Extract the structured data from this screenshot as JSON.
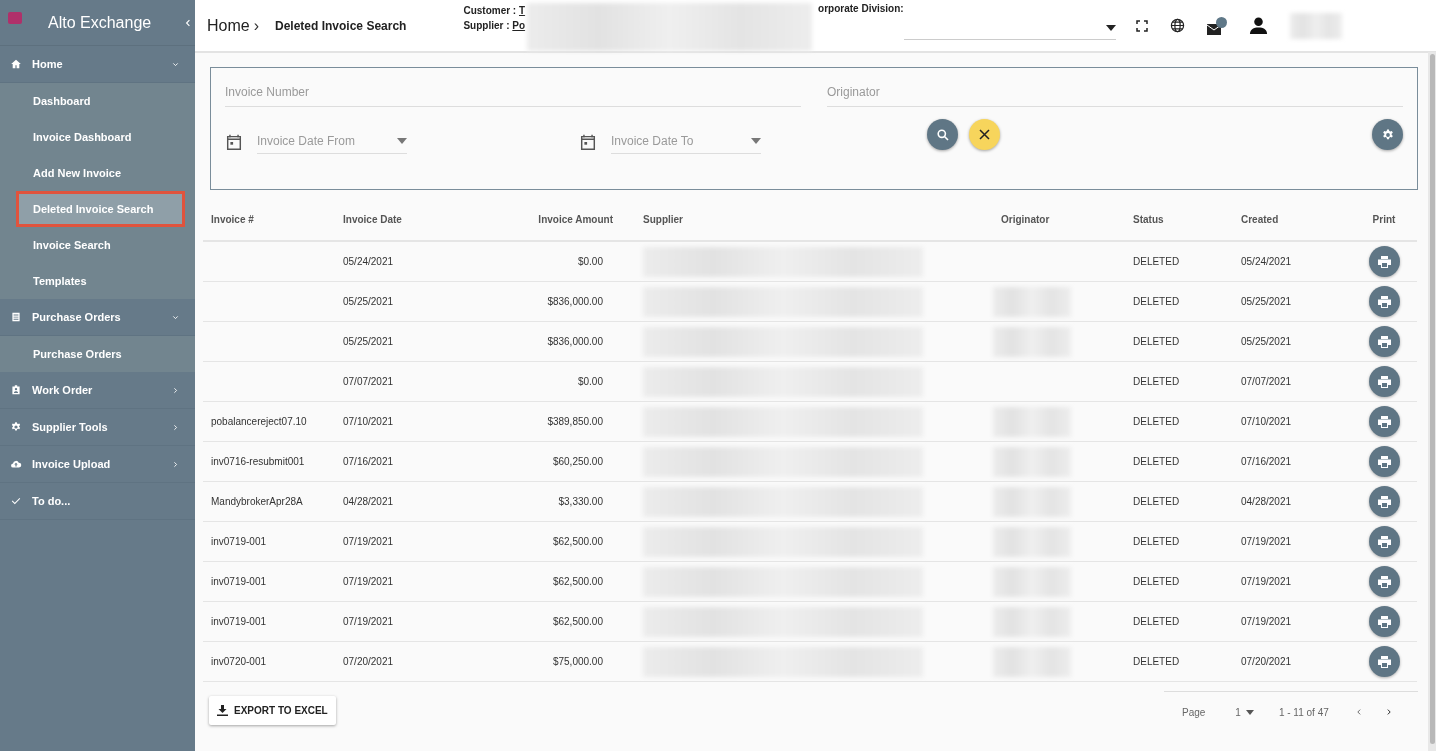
{
  "app": {
    "title": "Alto Exchange"
  },
  "sidebar": {
    "sections": [
      {
        "label": "Home",
        "kind": "group",
        "expanded": true,
        "children": [
          {
            "label": "Dashboard",
            "selected": false
          },
          {
            "label": "Invoice Dashboard",
            "selected": false
          },
          {
            "label": "Add New Invoice",
            "selected": false
          },
          {
            "label": "Deleted Invoice Search",
            "selected": true
          },
          {
            "label": "Invoice Search",
            "selected": false
          },
          {
            "label": "Templates",
            "selected": false
          }
        ]
      },
      {
        "label": "Purchase Orders",
        "kind": "group",
        "expanded": true,
        "children": [
          {
            "label": "Purchase Orders",
            "selected": false
          }
        ]
      },
      {
        "label": "Work Order",
        "kind": "group",
        "expanded": false
      },
      {
        "label": "Supplier Tools",
        "kind": "group",
        "expanded": false
      },
      {
        "label": "Invoice Upload",
        "kind": "group",
        "expanded": false
      },
      {
        "label": "To do...",
        "kind": "link"
      }
    ]
  },
  "header": {
    "breadcrumb": "Home",
    "separator": "›",
    "title": "Deleted Invoice Search",
    "customer_label": "Customer :",
    "customer_value": "T",
    "supplier_label": "Supplier :",
    "supplier_value": "Po",
    "division_label": "orporate Division:"
  },
  "search": {
    "fields": [
      {
        "placeholder": "Invoice Number"
      },
      {
        "placeholder": "Originator"
      }
    ],
    "dates": [
      {
        "placeholder": "Invoice Date From"
      },
      {
        "placeholder": "Invoice Date To"
      }
    ]
  },
  "table": {
    "columns": [
      "Invoice #",
      "Invoice Date",
      "Invoice Amount",
      "Supplier",
      "Originator",
      "Status",
      "Created",
      "Print"
    ],
    "rows": [
      {
        "invoice": "",
        "date": "05/24/2021",
        "amount": "$0.00",
        "originator_redacted": false,
        "status": "DELETED",
        "created": "05/24/2021"
      },
      {
        "invoice": "",
        "date": "05/25/2021",
        "amount": "$836,000.00",
        "originator_redacted": true,
        "status": "DELETED",
        "created": "05/25/2021"
      },
      {
        "invoice": "",
        "date": "05/25/2021",
        "amount": "$836,000.00",
        "originator_redacted": true,
        "status": "DELETED",
        "created": "05/25/2021"
      },
      {
        "invoice": "",
        "date": "07/07/2021",
        "amount": "$0.00",
        "originator_redacted": false,
        "status": "DELETED",
        "created": "07/07/2021"
      },
      {
        "invoice": "pobalancereject07.10",
        "date": "07/10/2021",
        "amount": "$389,850.00",
        "originator_redacted": true,
        "status": "DELETED",
        "created": "07/10/2021"
      },
      {
        "invoice": "inv0716-resubmit001",
        "date": "07/16/2021",
        "amount": "$60,250.00",
        "originator_redacted": true,
        "status": "DELETED",
        "created": "07/16/2021"
      },
      {
        "invoice": "MandybrokerApr28A",
        "date": "04/28/2021",
        "amount": "$3,330.00",
        "originator_redacted": true,
        "status": "DELETED",
        "created": "04/28/2021"
      },
      {
        "invoice": "inv0719-001",
        "date": "07/19/2021",
        "amount": "$62,500.00",
        "originator_redacted": true,
        "status": "DELETED",
        "created": "07/19/2021"
      },
      {
        "invoice": "inv0719-001",
        "date": "07/19/2021",
        "amount": "$62,500.00",
        "originator_redacted": true,
        "status": "DELETED",
        "created": "07/19/2021"
      },
      {
        "invoice": "inv0719-001",
        "date": "07/19/2021",
        "amount": "$62,500.00",
        "originator_redacted": true,
        "status": "DELETED",
        "created": "07/19/2021"
      },
      {
        "invoice": "inv0720-001",
        "date": "07/20/2021",
        "amount": "$75,000.00",
        "originator_redacted": true,
        "status": "DELETED",
        "created": "07/20/2021"
      }
    ]
  },
  "footer": {
    "export_label": "EXPORT TO EXCEL",
    "page_label": "Page",
    "page_value": "1",
    "range": "1 - 11 of 47"
  }
}
